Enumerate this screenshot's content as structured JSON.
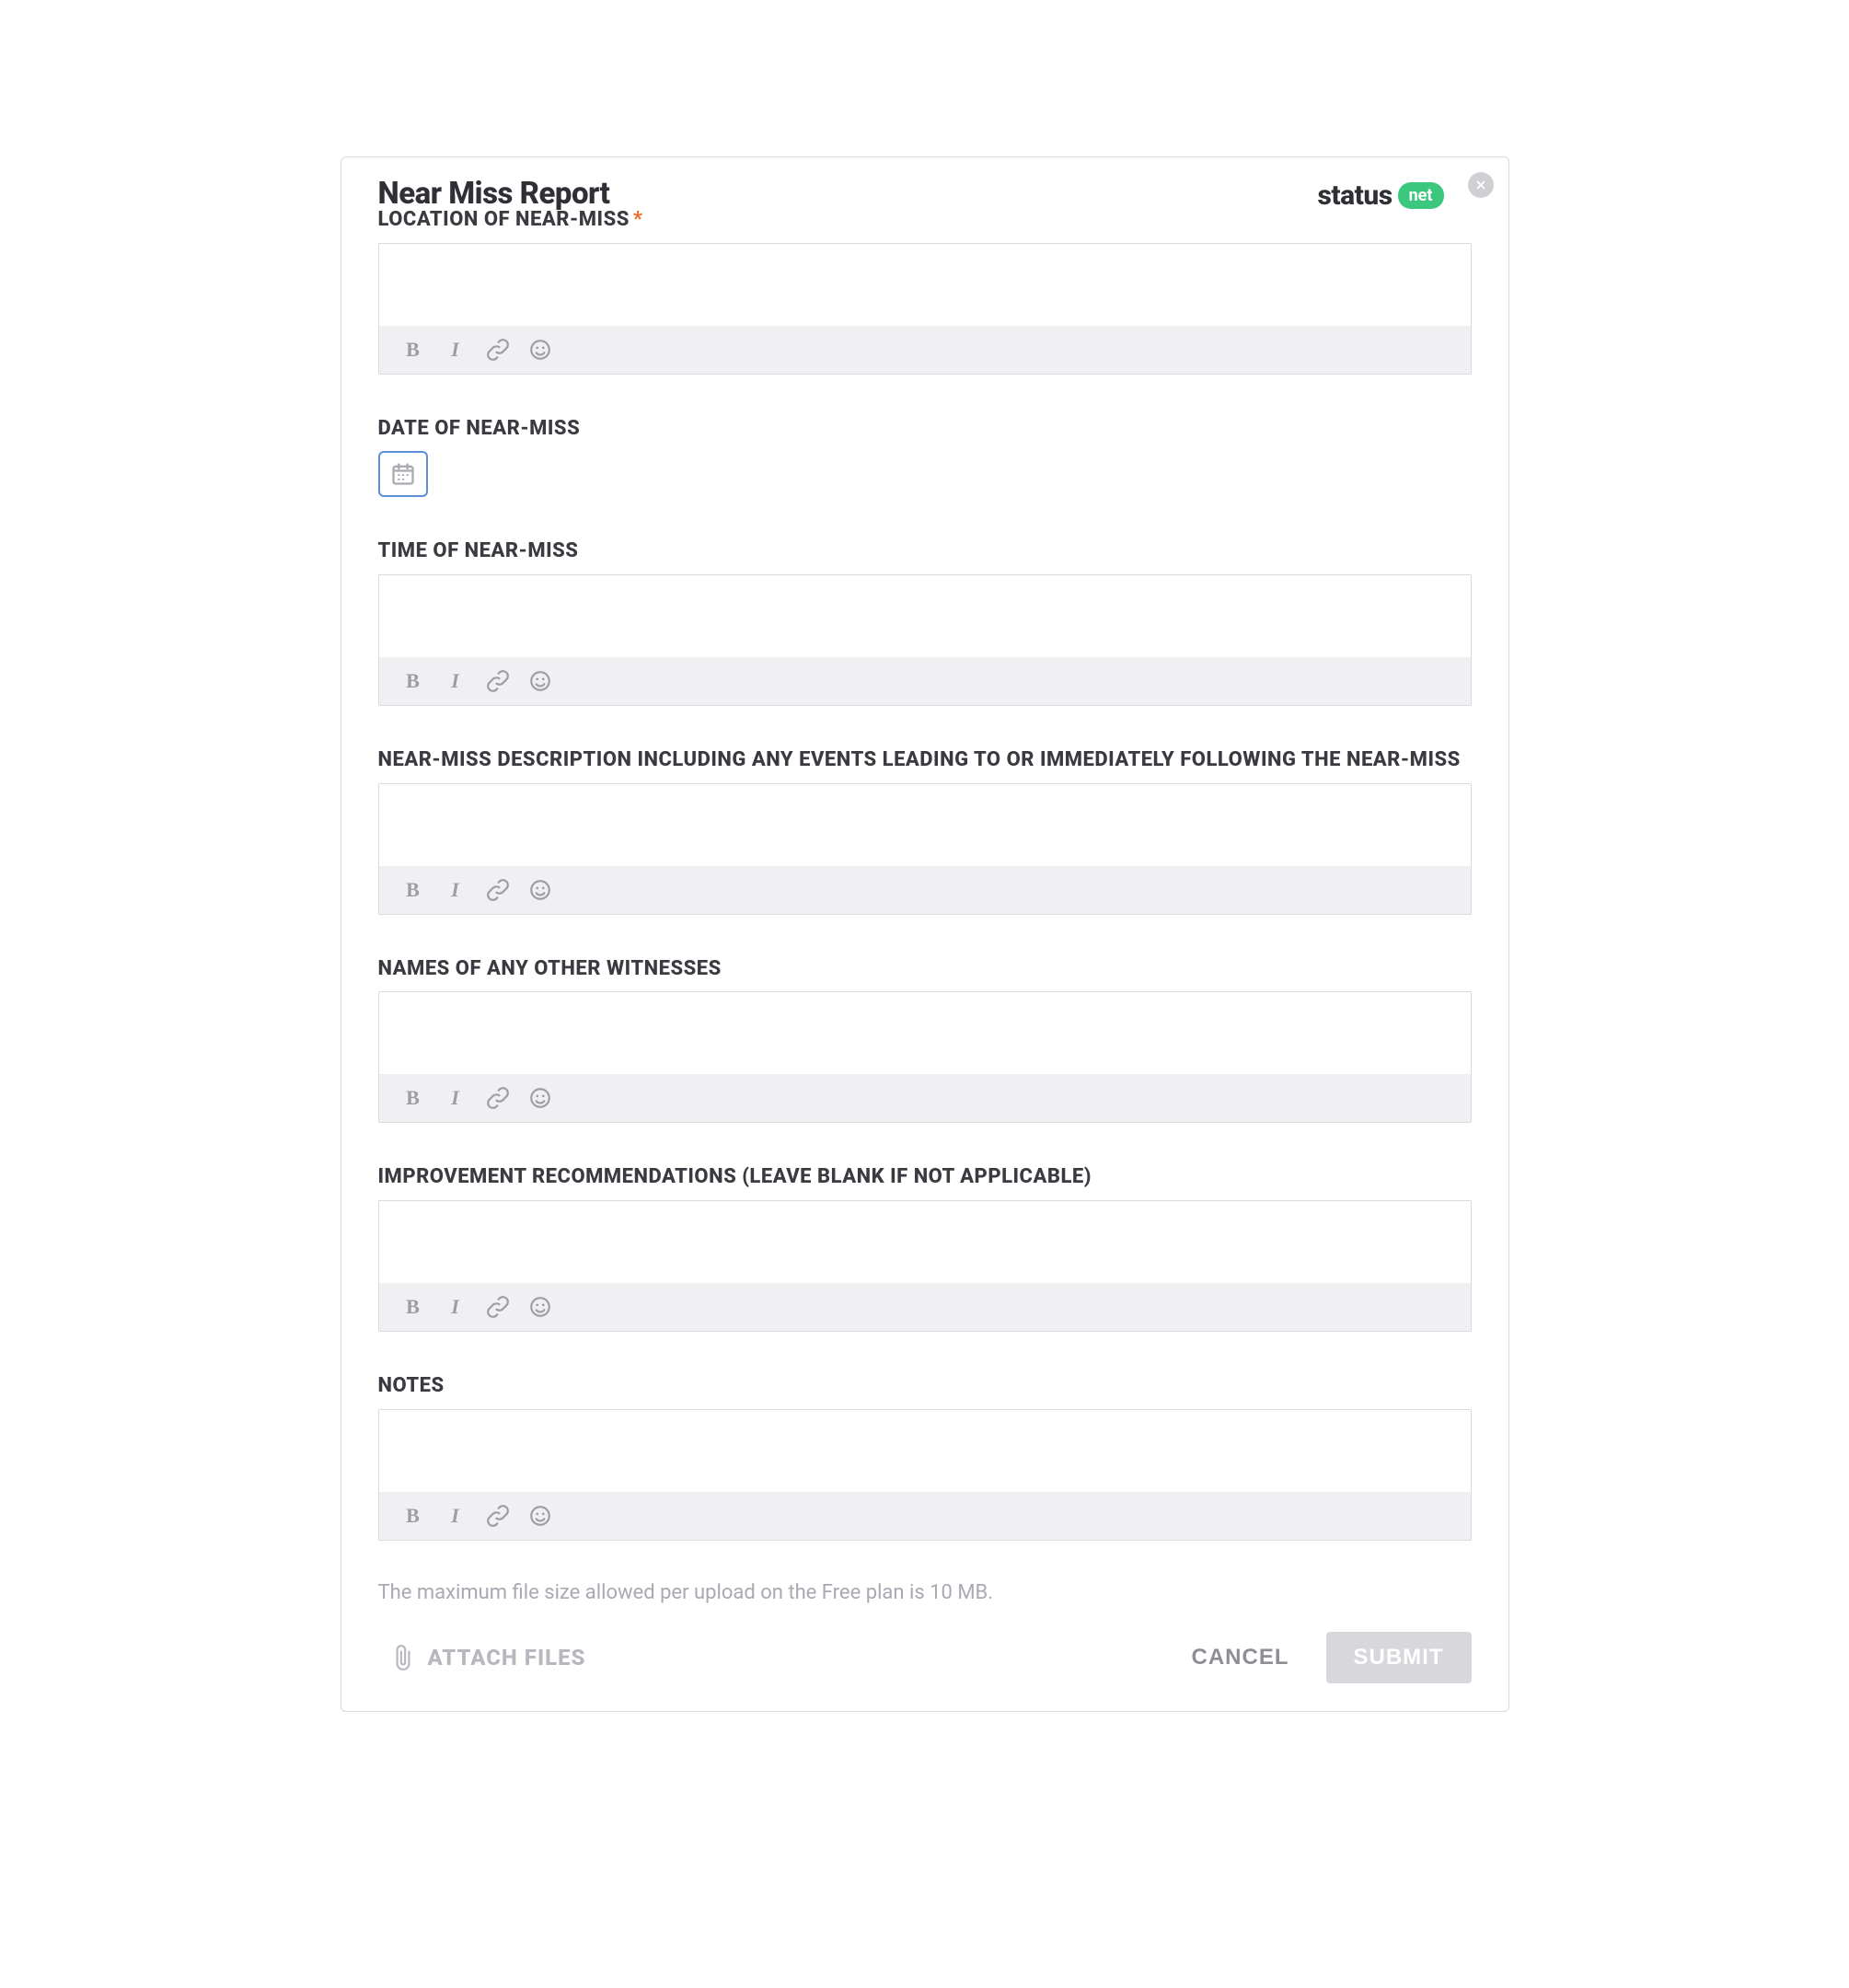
{
  "header": {
    "title": "Near Miss Report",
    "brand_text": "status",
    "brand_badge": "net"
  },
  "fields": {
    "location": {
      "label": "LOCATION OF NEAR-MISS",
      "required": true,
      "value": ""
    },
    "date": {
      "label": "DATE OF NEAR-MISS",
      "value": ""
    },
    "time": {
      "label": "TIME OF NEAR-MISS",
      "value": ""
    },
    "description": {
      "label": "NEAR-MISS DESCRIPTION INCLUDING ANY EVENTS LEADING TO OR IMMEDIATELY FOLLOWING THE NEAR-MISS",
      "value": ""
    },
    "witnesses": {
      "label": "NAMES OF ANY OTHER WITNESSES",
      "value": ""
    },
    "improvements": {
      "label": "IMPROVEMENT RECOMMENDATIONS (LEAVE BLANK IF NOT APPLICABLE)",
      "value": ""
    },
    "notes": {
      "label": "NOTES",
      "value": ""
    }
  },
  "toolbar_icons": {
    "bold": "B",
    "italic": "I"
  },
  "upload_note": "The maximum file size allowed per upload on the Free plan is 10 MB.",
  "footer": {
    "attach": "ATTACH FILES",
    "cancel": "CANCEL",
    "submit": "SUBMIT"
  },
  "required_marker": "*"
}
